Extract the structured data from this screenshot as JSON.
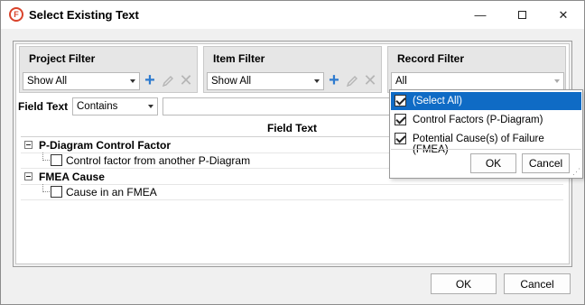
{
  "window": {
    "title": "Select Existing Text",
    "app_icon_letter": "F",
    "minimize_glyph": "—",
    "close_glyph": "✕"
  },
  "filters": {
    "project": {
      "title": "Project Filter",
      "value": "Show All"
    },
    "item": {
      "title": "Item Filter",
      "value": "Show All"
    },
    "record": {
      "title": "Record Filter",
      "value": "All"
    }
  },
  "icons": {
    "plus": "+",
    "edit": "✎",
    "delete": "✕"
  },
  "field_text_filter": {
    "label": "Field Text",
    "operator": "Contains",
    "value": ""
  },
  "grid": {
    "column_header": "Field Text",
    "groups": [
      {
        "label": "P-Diagram Control Factor",
        "items": [
          {
            "label": "Control factor from another P-Diagram",
            "checked": false
          }
        ]
      },
      {
        "label": "FMEA Cause",
        "items": [
          {
            "label": "Cause in an FMEA",
            "checked": false
          }
        ]
      }
    ]
  },
  "record_dropdown": {
    "options": [
      {
        "label": "(Select All)",
        "checked": true,
        "selected": true
      },
      {
        "label": "Control Factors (P-Diagram)",
        "checked": true,
        "selected": false
      },
      {
        "label": "Potential Cause(s) of Failure (FMEA)",
        "checked": true,
        "selected": false
      }
    ],
    "ok_label": "OK",
    "cancel_label": "Cancel",
    "grip_glyph": "⋰"
  },
  "footer": {
    "ok_label": "OK",
    "cancel_label": "Cancel"
  },
  "colors": {
    "selection": "#0f6bc5",
    "accent_plus": "#2e7bcf",
    "app_icon": "#d9432b"
  }
}
